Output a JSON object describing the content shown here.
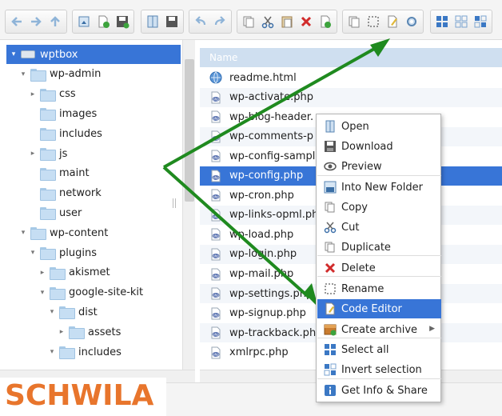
{
  "toolbar": {
    "icons": [
      "back-icon",
      "forward-icon",
      "up-icon",
      "reload-icon",
      "new-file-icon",
      "save-icon",
      "view-icon",
      "save-as-icon",
      "undo-icon",
      "redo-icon",
      "copy-icon",
      "cut-icon",
      "paste-icon",
      "delete-icon",
      "rename-icon",
      "duplicate-icon",
      "select-icon",
      "code-editor-icon",
      "settings-icon",
      "icons-view-icon",
      "list-view-icon",
      "tree-view-icon"
    ]
  },
  "tree": {
    "items": [
      {
        "label": "wptbox",
        "level": 0,
        "expander": "open",
        "kind": "drive",
        "selected": true
      },
      {
        "label": "wp-admin",
        "level": 1,
        "expander": "open"
      },
      {
        "label": "css",
        "level": 2,
        "expander": "closed"
      },
      {
        "label": "images",
        "level": 2,
        "expander": "none"
      },
      {
        "label": "includes",
        "level": 2,
        "expander": "none"
      },
      {
        "label": "js",
        "level": 2,
        "expander": "closed"
      },
      {
        "label": "maint",
        "level": 2,
        "expander": "none"
      },
      {
        "label": "network",
        "level": 2,
        "expander": "none"
      },
      {
        "label": "user",
        "level": 2,
        "expander": "none"
      },
      {
        "label": "wp-content",
        "level": 1,
        "expander": "open"
      },
      {
        "label": "plugins",
        "level": 2,
        "expander": "open"
      },
      {
        "label": "akismet",
        "level": 3,
        "expander": "closed"
      },
      {
        "label": "google-site-kit",
        "level": 3,
        "expander": "open"
      },
      {
        "label": "dist",
        "level": 4,
        "expander": "open"
      },
      {
        "label": "assets",
        "level": 5,
        "expander": "closed"
      },
      {
        "label": "includes",
        "level": 4,
        "expander": "open"
      }
    ]
  },
  "file_list": {
    "column_name": "Name",
    "files": [
      {
        "name": "readme.html",
        "icon": "html-file-icon"
      },
      {
        "name": "wp-activate.php",
        "icon": "php-file-icon"
      },
      {
        "name": "wp-blog-header.",
        "icon": "php-file-icon"
      },
      {
        "name": "wp-comments-p",
        "icon": "php-file-icon"
      },
      {
        "name": "wp-config-sampl",
        "icon": "php-file-icon"
      },
      {
        "name": "wp-config.php",
        "icon": "php-file-icon",
        "selected": true
      },
      {
        "name": "wp-cron.php",
        "icon": "php-file-icon"
      },
      {
        "name": "wp-links-opml.ph",
        "icon": "php-file-icon"
      },
      {
        "name": "wp-load.php",
        "icon": "php-file-icon"
      },
      {
        "name": "wp-login.php",
        "icon": "php-file-icon"
      },
      {
        "name": "wp-mail.php",
        "icon": "php-file-icon"
      },
      {
        "name": "wp-settings.php",
        "icon": "php-file-icon"
      },
      {
        "name": "wp-signup.php",
        "icon": "php-file-icon"
      },
      {
        "name": "wp-trackback.ph",
        "icon": "php-file-icon"
      },
      {
        "name": "xmlrpc.php",
        "icon": "php-file-icon"
      }
    ]
  },
  "context_menu": {
    "items": [
      {
        "label": "Open",
        "icon": "open-icon"
      },
      {
        "label": "Download",
        "icon": "download-icon"
      },
      {
        "label": "Preview",
        "icon": "preview-eye-icon"
      },
      {
        "label": "Into New Folder",
        "icon": "new-folder-icon"
      },
      {
        "label": "Copy",
        "icon": "copy-icon"
      },
      {
        "label": "Cut",
        "icon": "cut-icon"
      },
      {
        "label": "Duplicate",
        "icon": "duplicate-icon"
      },
      {
        "label": "Delete",
        "icon": "delete-icon"
      },
      {
        "label": "Rename",
        "icon": "rename-icon"
      },
      {
        "label": "Code Editor",
        "icon": "code-editor-icon",
        "active": true
      },
      {
        "label": "Create archive",
        "icon": "archive-icon",
        "submenu": true
      },
      {
        "label": "Select all",
        "icon": "select-all-icon"
      },
      {
        "label": "Invert selection",
        "icon": "invert-selection-icon"
      },
      {
        "label": "Get Info & Share",
        "icon": "info-icon"
      }
    ]
  },
  "watermark": {
    "text": "SCHWILA"
  },
  "colors": {
    "selection": "#3875d7",
    "arrow": "#1f8a1f",
    "brand": "#e8752c"
  }
}
